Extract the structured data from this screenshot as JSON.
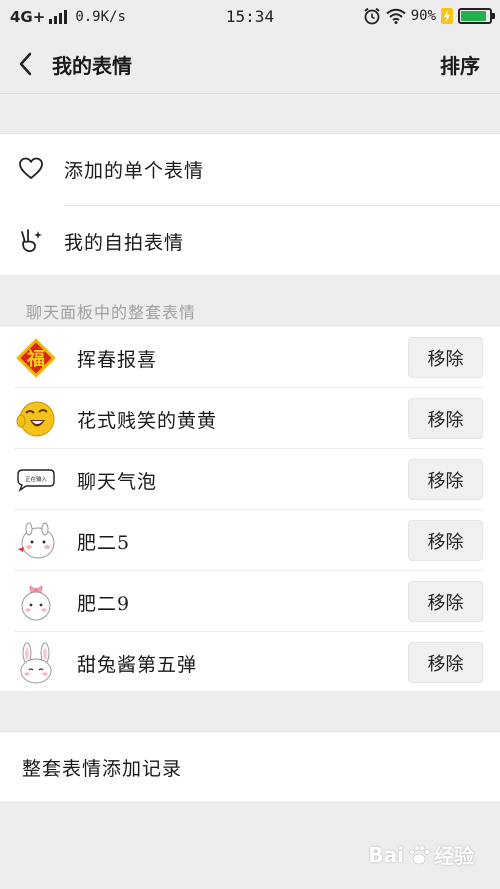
{
  "status_bar": {
    "network": "4G+",
    "speed": "0.9K/s",
    "time": "15:34",
    "battery": "90%",
    "battery_level": 0.9
  },
  "header": {
    "title": "我的表情",
    "sort_label": "排序"
  },
  "my_stickers": [
    {
      "label": "添加的单个表情",
      "icon": "heart-icon"
    },
    {
      "label": "我的自拍表情",
      "icon": "victory-hand-icon"
    }
  ],
  "section_title": "聊天面板中的整套表情",
  "remove_label": "移除",
  "packs": [
    {
      "name": "挥春报喜",
      "icon": "fu-charm-icon"
    },
    {
      "name": "花式贱笑的黄黄",
      "icon": "laughing-emoji-icon"
    },
    {
      "name": "聊天气泡",
      "icon": "chat-bubble-icon"
    },
    {
      "name": "肥二5",
      "icon": "bunny-sticker-icon"
    },
    {
      "name": "肥二9",
      "icon": "bunny-bow-sticker-icon"
    },
    {
      "name": "甜兔酱第五弹",
      "icon": "rabbit-sticker-icon"
    }
  ],
  "thumb_text": {
    "fu": "福",
    "bubble": "正在输入"
  },
  "history_label": "整套表情添加记录",
  "watermark": {
    "brand": "Bai",
    "suffix": "经验"
  },
  "colors": {
    "fu_red": "#d9261c",
    "fu_gold": "#f5b400",
    "emoji_yellow": "#f4c21a",
    "battery_green": "#22b14c"
  }
}
